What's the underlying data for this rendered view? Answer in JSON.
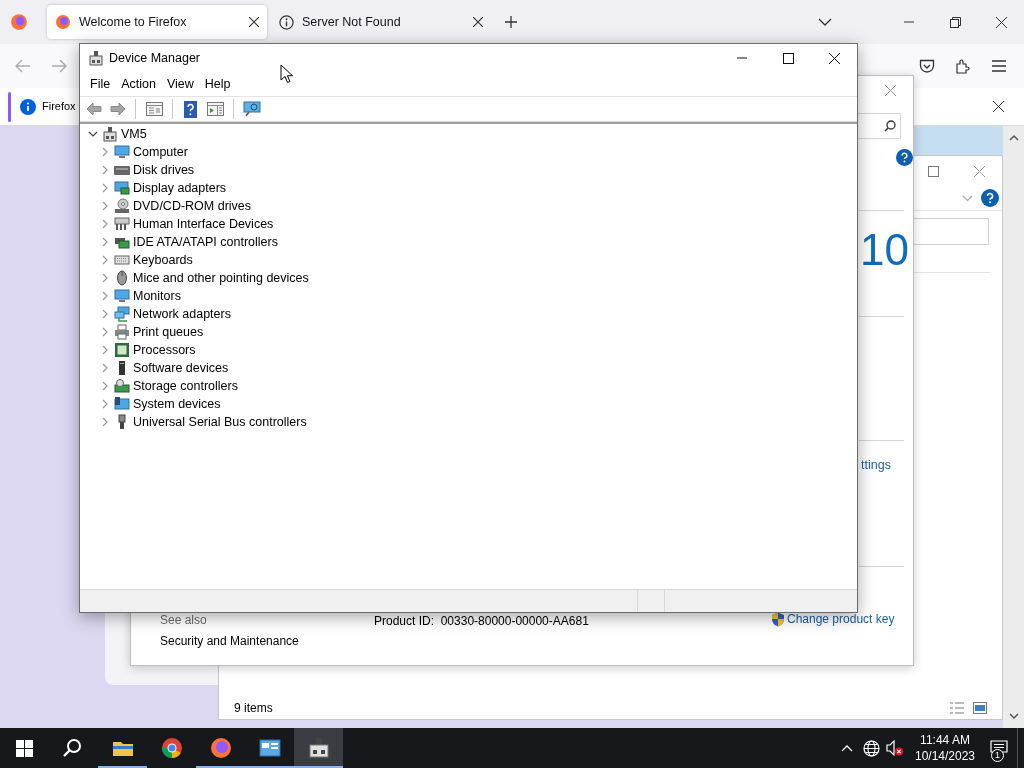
{
  "browser": {
    "tabs": [
      {
        "label": "Welcome to Firefox",
        "selected": true
      },
      {
        "label": "Server Not Found",
        "selected": false
      }
    ],
    "notification": "Firefox"
  },
  "system_window": {
    "heading_fragment": "10",
    "link_fragment": "ttings",
    "see_also": "See also",
    "links": [
      "Security and Maintenance"
    ],
    "product_id_label": "Product ID:",
    "product_id": "00330-80000-00000-AA681",
    "change_key": "Change product key"
  },
  "explorer_window": {
    "status": "9 items"
  },
  "device_manager": {
    "title": "Device Manager",
    "menu": [
      "File",
      "Action",
      "View",
      "Help"
    ],
    "tree": {
      "label": "VM5",
      "expanded": true,
      "children": [
        {
          "label": "Computer",
          "kind": "computer",
          "expanded": false
        },
        {
          "label": "Disk drives",
          "kind": "disk",
          "expanded": false
        },
        {
          "label": "Display adapters",
          "kind": "display",
          "expanded": false
        },
        {
          "label": "DVD/CD-ROM drives",
          "kind": "dvd",
          "expanded": false
        },
        {
          "label": "Human Interface Devices",
          "kind": "hid",
          "expanded": false
        },
        {
          "label": "IDE ATA/ATAPI controllers",
          "kind": "ide",
          "expanded": false
        },
        {
          "label": "Keyboards",
          "kind": "keyboard",
          "expanded": false
        },
        {
          "label": "Mice and other pointing devices",
          "kind": "mouse",
          "expanded": false
        },
        {
          "label": "Monitors",
          "kind": "monitor",
          "expanded": false
        },
        {
          "label": "Network adapters",
          "kind": "network",
          "expanded": false
        },
        {
          "label": "Print queues",
          "kind": "printer",
          "expanded": false
        },
        {
          "label": "Processors",
          "kind": "processor",
          "expanded": false
        },
        {
          "label": "Software devices",
          "kind": "software",
          "expanded": false
        },
        {
          "label": "Storage controllers",
          "kind": "storage",
          "expanded": false
        },
        {
          "label": "System devices",
          "kind": "system",
          "expanded": false
        },
        {
          "label": "Universal Serial Bus controllers",
          "kind": "usb",
          "expanded": false
        }
      ]
    }
  },
  "taskbar": {
    "apps": [
      {
        "kind": "files",
        "running": true,
        "selected": false
      },
      {
        "kind": "chrome",
        "running": false,
        "selected": false
      },
      {
        "kind": "firefox",
        "running": true,
        "selected": false
      },
      {
        "kind": "control-panel",
        "running": true,
        "selected": false
      },
      {
        "kind": "device-manager",
        "running": true,
        "selected": true
      }
    ],
    "time": "11:44 AM",
    "date": "10/14/2023",
    "notifications": "1"
  }
}
